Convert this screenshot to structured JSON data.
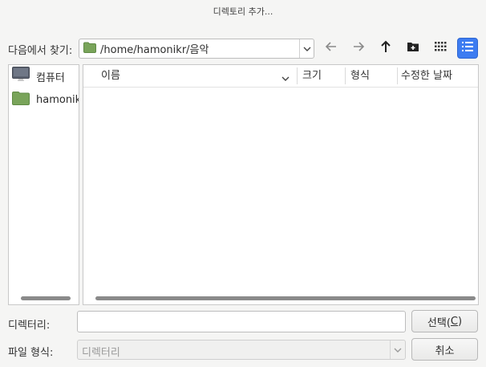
{
  "window": {
    "title": "디렉토리 추가..."
  },
  "toolbar": {
    "look_in_label": "다음에서 찾기:",
    "path": "/home/hamonikr/음악",
    "buttons": [
      {
        "name": "back",
        "icon": "arrow-left-icon"
      },
      {
        "name": "forward",
        "icon": "arrow-right-icon"
      },
      {
        "name": "parent",
        "icon": "arrow-up-icon"
      },
      {
        "name": "new-folder",
        "icon": "new-folder-icon"
      },
      {
        "name": "icon-view",
        "icon": "grid-view-icon"
      },
      {
        "name": "detail-view",
        "icon": "list-view-icon",
        "active": true
      }
    ]
  },
  "sidebar": {
    "items": [
      {
        "label": "컴퓨터",
        "icon": "computer-icon"
      },
      {
        "label": "hamonikr",
        "icon": "folder-icon"
      }
    ]
  },
  "filelist": {
    "columns": [
      "이름",
      "크기",
      "형식",
      "수정한 날짜"
    ],
    "rows": []
  },
  "footer": {
    "directory_label": "디렉터리:",
    "directory_value": "",
    "filetype_label": "파일 형식:",
    "filetype_value": "디렉터리",
    "select_button_prefix": "선택(",
    "select_button_mnemonic": "C",
    "select_button_suffix": ")",
    "cancel_button": "취소"
  },
  "colors": {
    "accent": "#3d7cf1",
    "folder": "#79a45a",
    "background": "#f5f5f4"
  }
}
